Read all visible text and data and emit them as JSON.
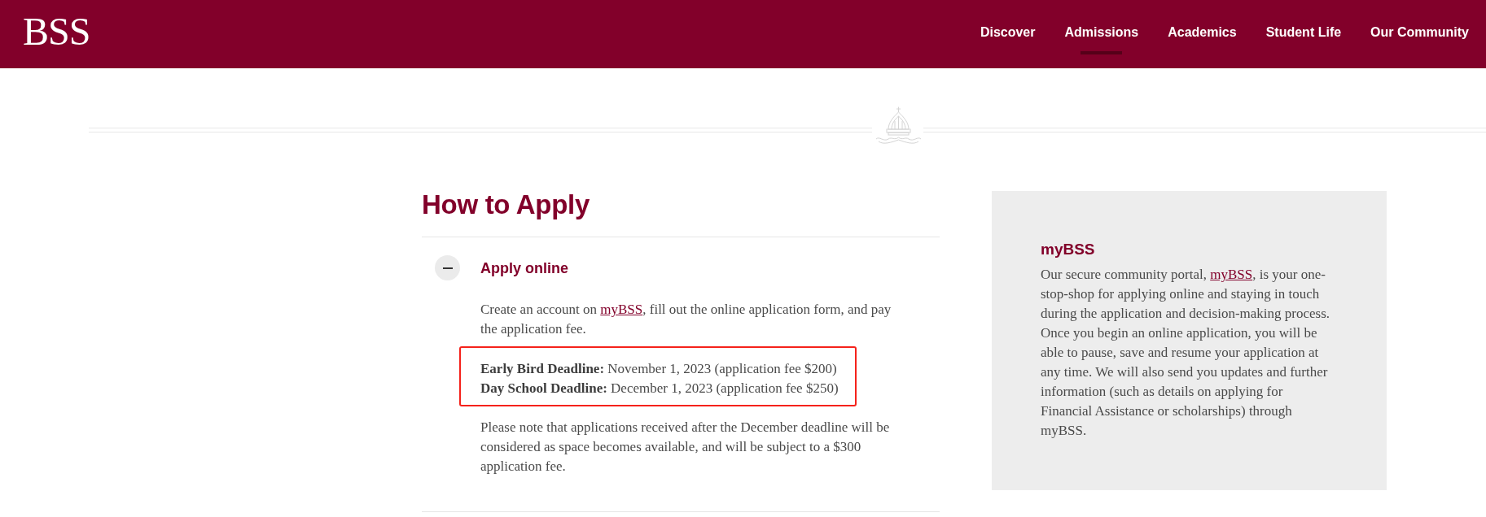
{
  "header": {
    "logo": "BSS",
    "nav": [
      {
        "label": "Discover",
        "selected": false
      },
      {
        "label": "Admissions",
        "selected": true
      },
      {
        "label": "Academics",
        "selected": false
      },
      {
        "label": "Student Life",
        "selected": false
      },
      {
        "label": "Our Community",
        "selected": false
      }
    ]
  },
  "main": {
    "title": "How to Apply",
    "sections": [
      {
        "title": "Apply online",
        "expanded": true,
        "intro": {
          "before": "Create an account on ",
          "link": "myBSS",
          "after": ", fill out the online application form, and pay the application fee."
        },
        "deadlines": {
          "highlighted": true,
          "lines": [
            "**Early Bird Deadline:** November 1, 2023 (application fee $200)",
            "**Day School Deadline:** December 1, 2023 (application fee $250)"
          ]
        },
        "note": "Please note that applications received after the December deadline will be considered as space becomes available, and will be subject to a $300 application fee."
      }
    ]
  },
  "sidebar": {
    "title": "myBSS",
    "text": {
      "before": "Our secure community portal, ",
      "link": "myBSS",
      "after": ", is your one-stop-shop for applying online and staying in touch during the application and decision-making process. Once you begin an online application, you will be able to pause, save and resume your application at any time. We will also send you updates and further information (such as details on applying for Financial Assistance or scholarships) through myBSS."
    }
  }
}
